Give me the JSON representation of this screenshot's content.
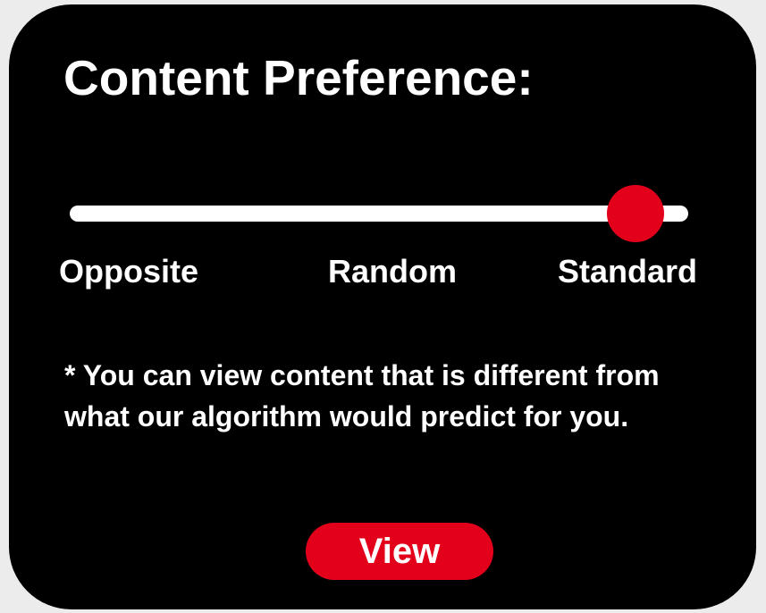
{
  "header": {
    "title": "Content Preference:"
  },
  "slider": {
    "options": [
      "Opposite",
      "Random",
      "Standard"
    ],
    "selected": "Standard",
    "value_fraction": 0.915
  },
  "note": {
    "text": "* You can view content that is different from what our algorithm would predict for you."
  },
  "actions": {
    "view_label": "View"
  },
  "colors": {
    "panel_background": "#000000",
    "page_background": "#ececec",
    "accent": "#e3001b",
    "text": "#ffffff"
  }
}
